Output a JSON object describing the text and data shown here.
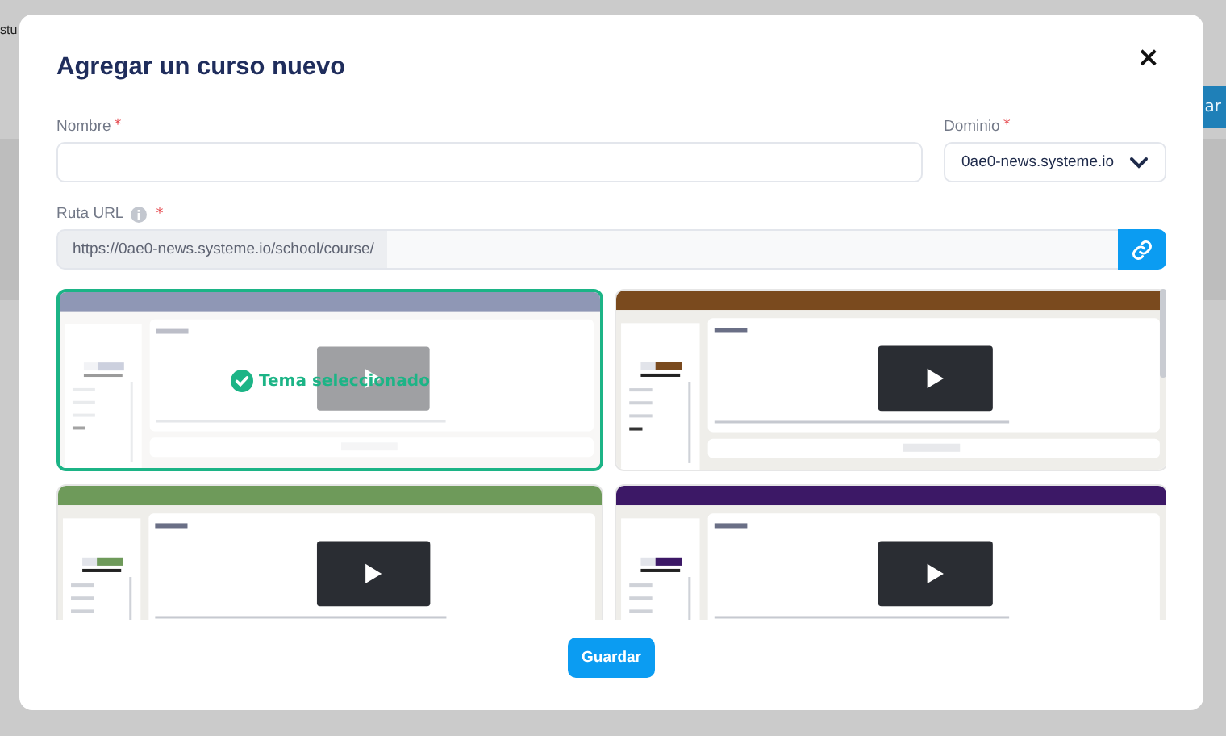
{
  "background_page": {
    "title_fragment": "stu",
    "button_fragment": "ar"
  },
  "dialog": {
    "title": "Agregar un curso nuevo",
    "close": "×"
  },
  "fields": {
    "name": {
      "label": "Nombre",
      "required_mark": "*"
    },
    "domain": {
      "label": "Dominio",
      "required_mark": "*",
      "value": "0ae0-news.systeme.io"
    },
    "url": {
      "label": "Ruta URL",
      "required_mark": "*",
      "prefix": "https://0ae0-news.systeme.io/school/course/"
    }
  },
  "themes": [
    {
      "color": "#8f97b5",
      "selected": true
    },
    {
      "color": "#7a4a1e",
      "selected": false
    },
    {
      "color": "#6e9a5a",
      "selected": false
    },
    {
      "color": "#3c1866",
      "selected": false
    }
  ],
  "selected_label": "Tema seleccionado",
  "save_button": "Guardar"
}
